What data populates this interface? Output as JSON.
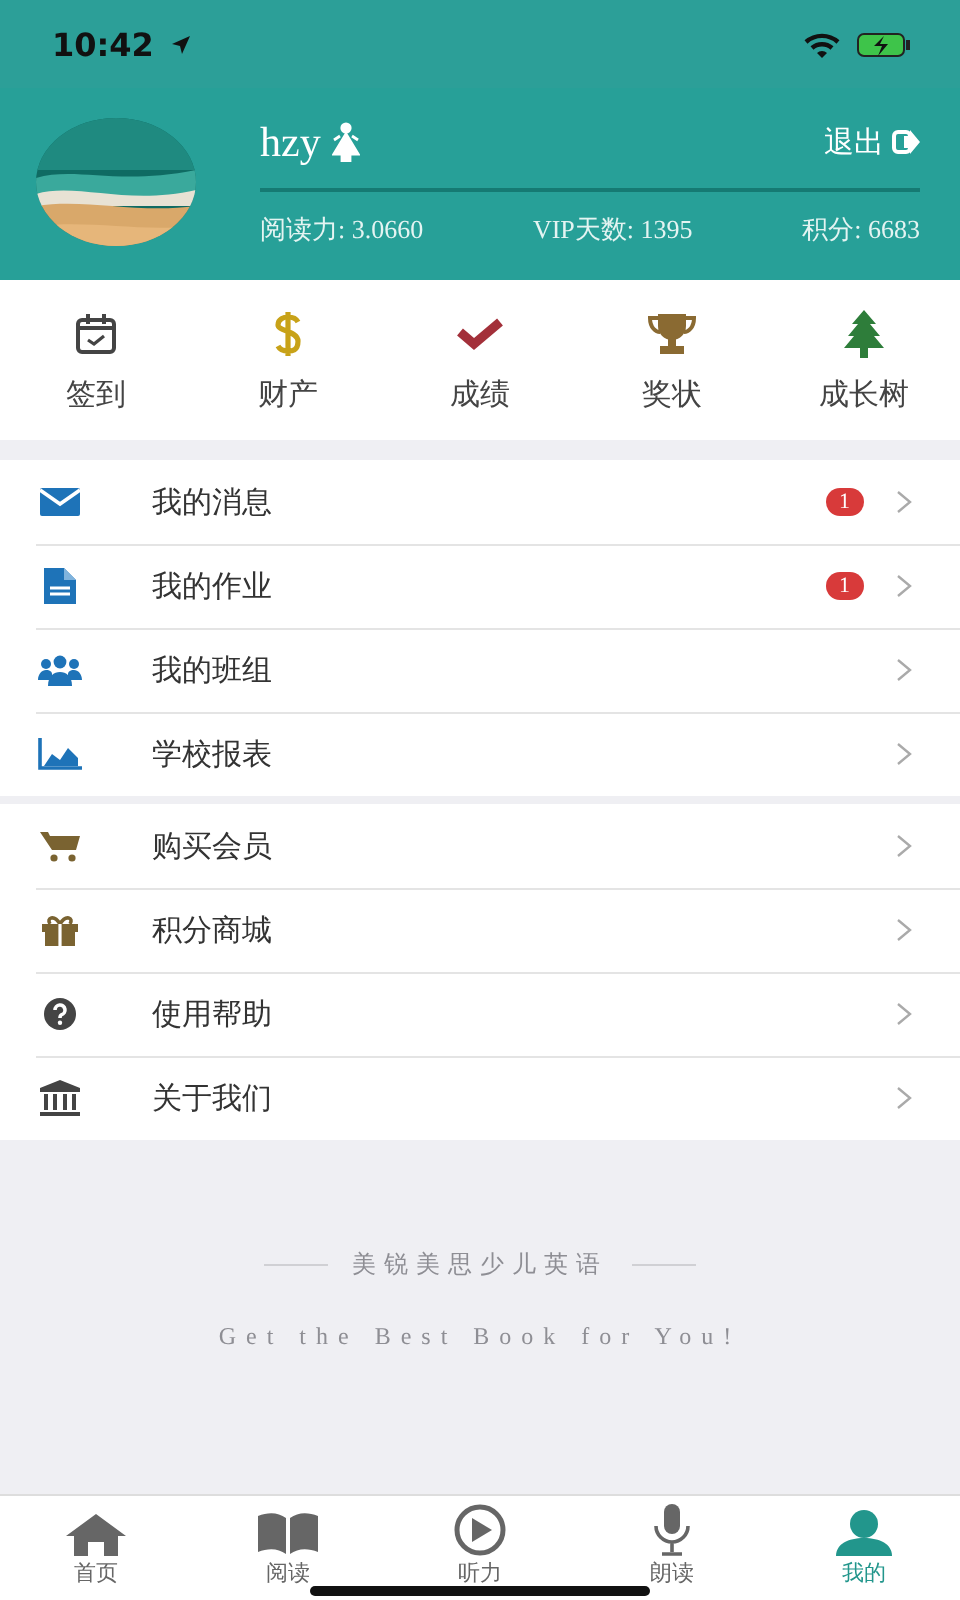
{
  "status_bar": {
    "time": "10:42"
  },
  "profile": {
    "name": "hzy",
    "logout": "退出",
    "stats": [
      "阅读力: 3.0660",
      "VIP天数: 1395",
      "积分: 6683"
    ]
  },
  "shortcuts": [
    {
      "kind": "calendar",
      "label": "签到"
    },
    {
      "kind": "dollar",
      "label": "财产"
    },
    {
      "kind": "check",
      "label": "成绩"
    },
    {
      "kind": "trophy",
      "label": "奖状"
    },
    {
      "kind": "tree",
      "label": "成长树"
    }
  ],
  "menu_groups": [
    [
      {
        "kind": "mail",
        "label": "我的消息",
        "badge": "1"
      },
      {
        "kind": "file",
        "label": "我的作业",
        "badge": "1"
      },
      {
        "kind": "group",
        "label": "我的班组"
      },
      {
        "kind": "chart",
        "label": "学校报表"
      }
    ],
    [
      {
        "kind": "cart",
        "label": "购买会员"
      },
      {
        "kind": "gift",
        "label": "积分商城"
      },
      {
        "kind": "help",
        "label": "使用帮助"
      },
      {
        "kind": "bank",
        "label": "关于我们"
      }
    ]
  ],
  "footer": {
    "brand": "美锐美思少儿英语",
    "slogan": "Get the Best Book for You!"
  },
  "tab_bar": [
    {
      "kind": "home",
      "label": "首页",
      "selected": false
    },
    {
      "kind": "book",
      "label": "阅读",
      "selected": false
    },
    {
      "kind": "play",
      "label": "听力",
      "selected": false
    },
    {
      "kind": "mic",
      "label": "朗读",
      "selected": false
    },
    {
      "kind": "user",
      "label": "我的",
      "selected": true
    }
  ]
}
